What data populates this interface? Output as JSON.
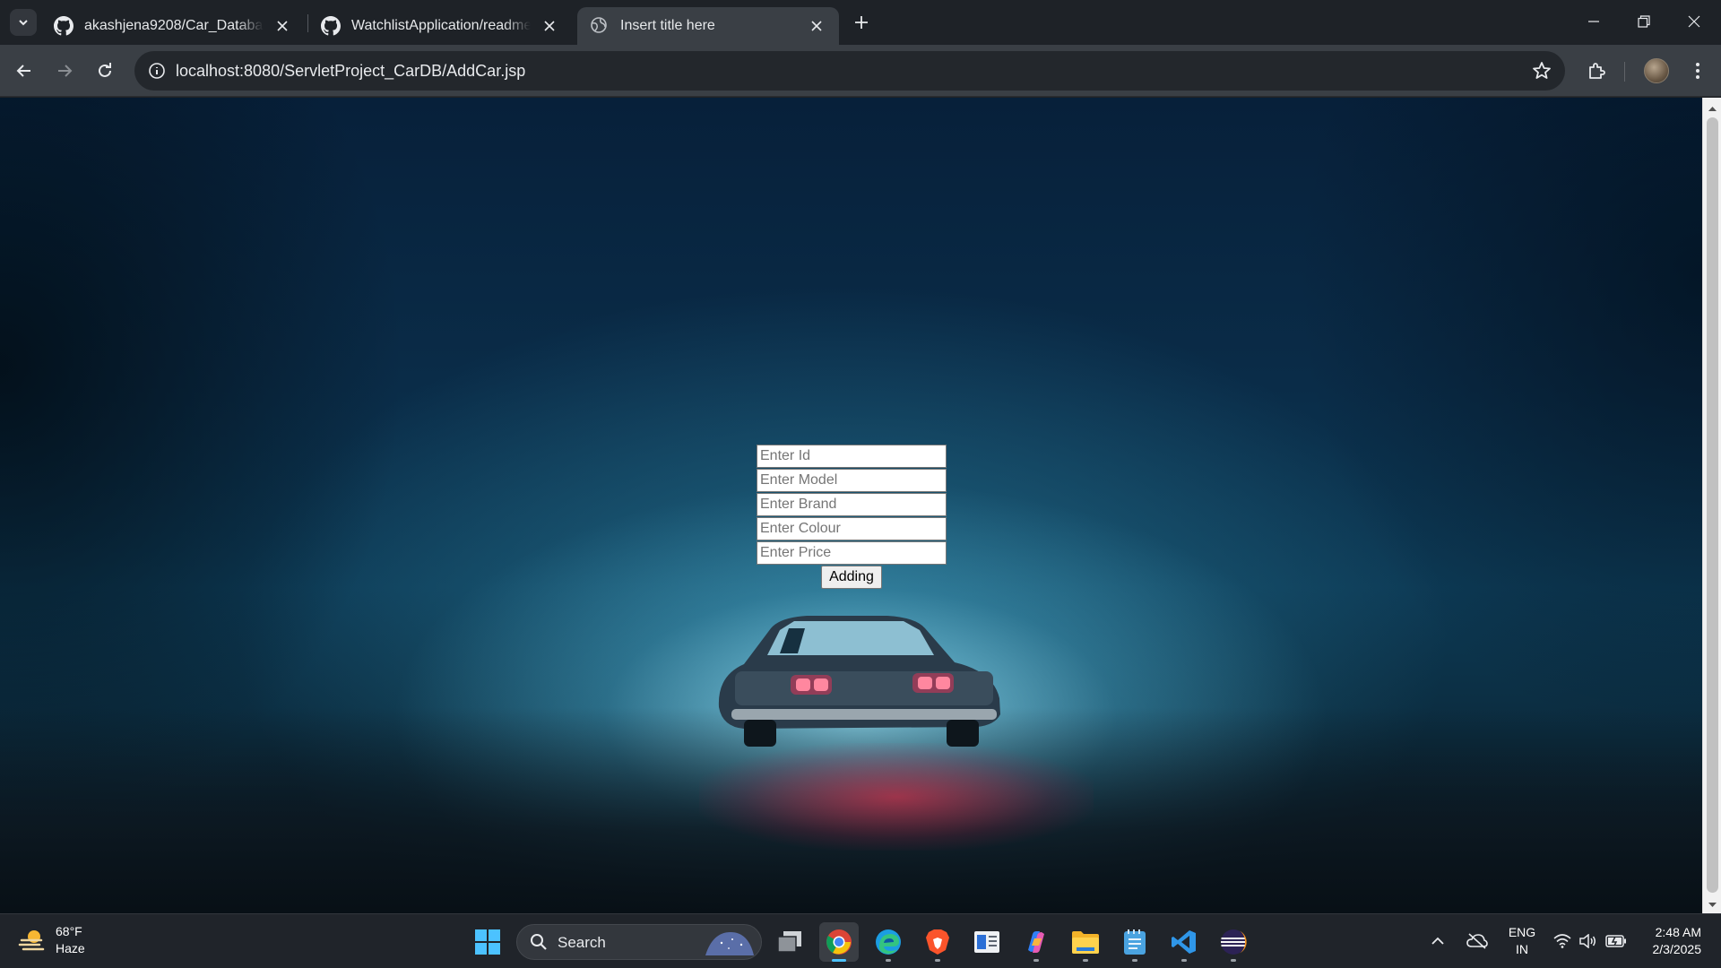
{
  "browser": {
    "tabs": [
      {
        "title": "akashjena9208/Car_Database_M",
        "favicon": "github-icon",
        "active": false
      },
      {
        "title": "WatchlistApplication/readme.m",
        "favicon": "github-icon",
        "active": false
      },
      {
        "title": "Insert title here",
        "favicon": "globe-icon",
        "active": true
      }
    ],
    "address": "localhost:8080/ServletProject_CarDB/AddCar.jsp"
  },
  "page": {
    "form": {
      "id_placeholder": "Enter Id",
      "model_placeholder": "Enter Model",
      "brand_placeholder": "Enter Brand",
      "colour_placeholder": "Enter Colour",
      "price_placeholder": "Enter Price",
      "submit_label": "Adding"
    },
    "background": "foggy-road-car-photo"
  },
  "taskbar": {
    "weather": {
      "temp": "68°F",
      "condition": "Haze"
    },
    "search_label": "Search",
    "apps": [
      "task-view",
      "chrome",
      "edge",
      "brave",
      "news",
      "copilot",
      "file-explorer",
      "notepad",
      "vscode",
      "eclipse"
    ],
    "language": {
      "line1": "ENG",
      "line2": "IN"
    },
    "clock": {
      "time": "2:48 AM",
      "date": "2/3/2025"
    }
  },
  "colors": {
    "accent": "#4cc2ff",
    "browser_frame": "#1e2227",
    "toolbar": "#3a3f45"
  }
}
